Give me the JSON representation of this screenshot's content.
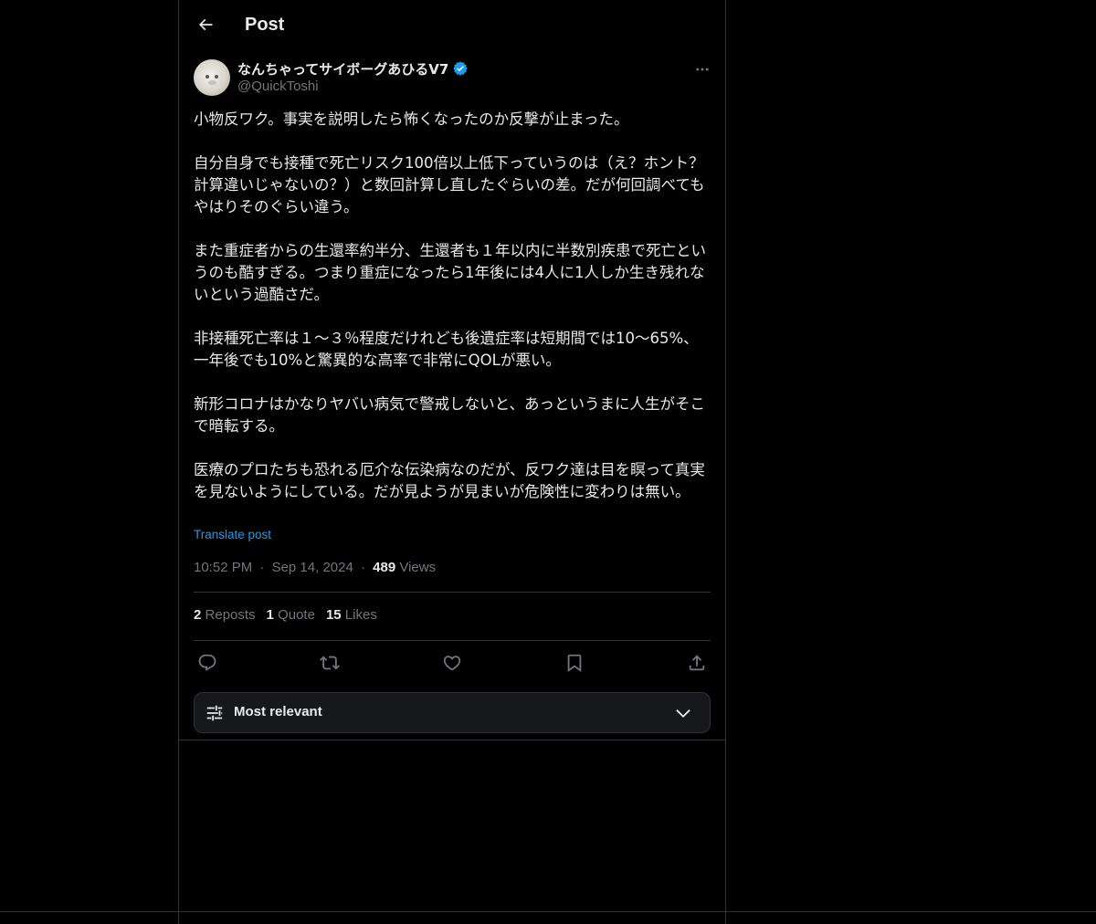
{
  "header": {
    "title": "Post",
    "back_icon": "arrow-left-icon"
  },
  "author": {
    "display_name": "なんちゃってサイボーグあひるV7",
    "handle": "@QuickToshi",
    "verified": true,
    "verified_color": "#1d9bf0"
  },
  "post": {
    "body": "小物反ワク。事実を説明したら怖くなったのか反撃が止まった。\n\n自分自身でも接種で死亡リスク100倍以上低下っていうのは（え？ホント？計算違いじゃないの？）と数回計算し直したぐらいの差。だが何回調べてもやはりそのぐらい違う。\n\nまた重症者からの生還率約半分、生還者も１年以内に半数別疾患で死亡というのも酷すぎる。つまり重症になったら1年後には4人に1人しか生き残れないという過酷さだ。\n\n非接種死亡率は１〜３％程度だけれども後遺症率は短期間では10〜65%、一年後でも10%と驚異的な高率で非常にQOLが悪い。\n\n新形コロナはかなりヤバい病気で警戒しないと、あっというまに人生がそこで暗転する。\n\n医療のプロたちも恐れる厄介な伝染病なのだが、反ワク達は目を瞑って真実を見ないようにしている。だが見ようが見まいが危険性に変わりは無い。",
    "translate_label": "Translate post",
    "time": "10:52 PM",
    "date": "Sep 14, 2024",
    "separator": "·",
    "views_count": "489",
    "views_label": "Views"
  },
  "stats": {
    "reposts_count": "2",
    "reposts_label": "Reposts",
    "quotes_count": "1",
    "quotes_label": "Quote",
    "likes_count": "15",
    "likes_label": "Likes"
  },
  "actions": [
    "reply-icon",
    "repost-icon",
    "like-icon",
    "bookmark-icon",
    "share-icon"
  ],
  "sort": {
    "label": "Most relevant",
    "icon": "tune-icon",
    "chevron": "chevron-down-icon"
  },
  "colors": {
    "background": "#000000",
    "text": "#e7e9ea",
    "secondary": "#71767b",
    "border": "#2f3336",
    "accent": "#1d9bf0"
  }
}
